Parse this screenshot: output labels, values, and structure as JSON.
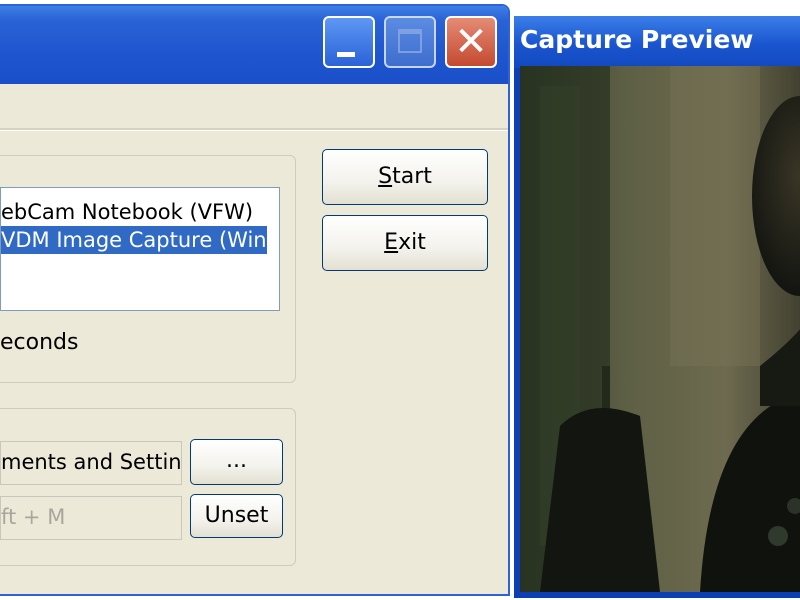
{
  "main_window": {
    "controls": {
      "minimize": "minimize",
      "maximize": "maximize",
      "close": "close"
    },
    "device_list": {
      "items": [
        {
          "label": "ebCam Notebook (VFW)",
          "selected": false
        },
        {
          "label": "VDM Image Capture (Win",
          "selected": true
        }
      ]
    },
    "interval_suffix": "econds",
    "buttons": {
      "start": {
        "accel": "S",
        "rest": "tart"
      },
      "exit": {
        "accel": "E",
        "rest": "xit"
      },
      "browse": "...",
      "unset": "Unset"
    },
    "folder_field": {
      "value": "ments and Settin"
    },
    "hotkey_field": {
      "value": "ft + M"
    }
  },
  "preview_window": {
    "title": "Capture Preview"
  },
  "colors": {
    "titlebar_blue": "#1f56cf",
    "selection_blue": "#316ac5",
    "dialog_bg": "#ece9d8",
    "close_red": "#c44a31"
  }
}
